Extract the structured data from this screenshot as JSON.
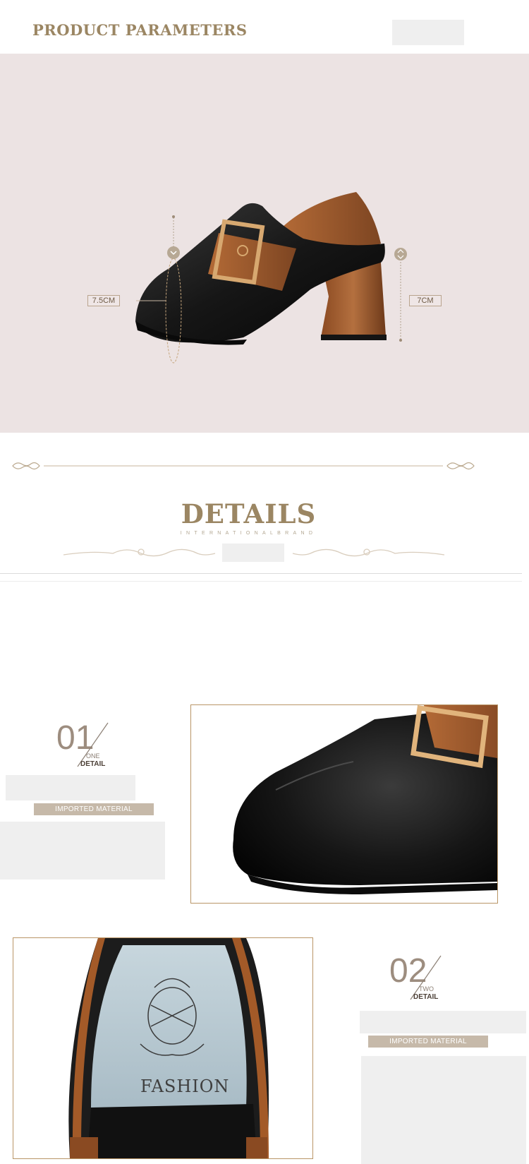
{
  "header": {
    "title": "PRODUCT PARAMETERS"
  },
  "parameters": {
    "toe_height_label": "7.5CM",
    "heel_height_label": "7CM"
  },
  "details": {
    "title": "DETAILS",
    "subtitle": "INTERNATIONALBRAND"
  },
  "detail_items": [
    {
      "number": "01",
      "word": "ONE",
      "label": "DETAIL",
      "badge": "IMPORTED MATERIAL"
    },
    {
      "number": "02",
      "word": "TWO",
      "label": "DETAIL",
      "badge": "IMPORTED MATERIAL"
    }
  ],
  "insole": {
    "brand_text": "FASHION"
  },
  "colors": {
    "accent": "#9b8663",
    "panel": "#ece3e3",
    "leather_black": "#1a1a1a",
    "leather_tan": "#9c5a2e"
  }
}
